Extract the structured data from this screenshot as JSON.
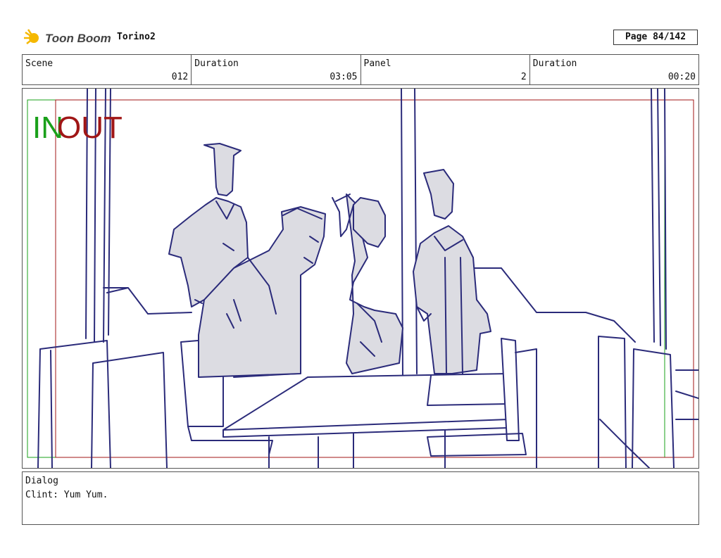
{
  "header": {
    "logo_text": "Toon Boom",
    "project": "Torino2",
    "page_label": "Page",
    "page_value": "84/142"
  },
  "info": {
    "scene_label": "Scene",
    "scene_value": "012",
    "scene_duration_label": "Duration",
    "scene_duration_value": "03:05",
    "panel_label": "Panel",
    "panel_value": "2",
    "panel_duration_label": "Duration",
    "panel_duration_value": "00:20"
  },
  "panel": {
    "in_label": "IN",
    "out_label": "OUT",
    "colors": {
      "in": "#1aa01a",
      "out": "#a01616",
      "sketch": "#2b2b7a",
      "fill": "#dcdce2"
    }
  },
  "dialog": {
    "label": "Dialog",
    "text": "Clint: Yum Yum."
  }
}
